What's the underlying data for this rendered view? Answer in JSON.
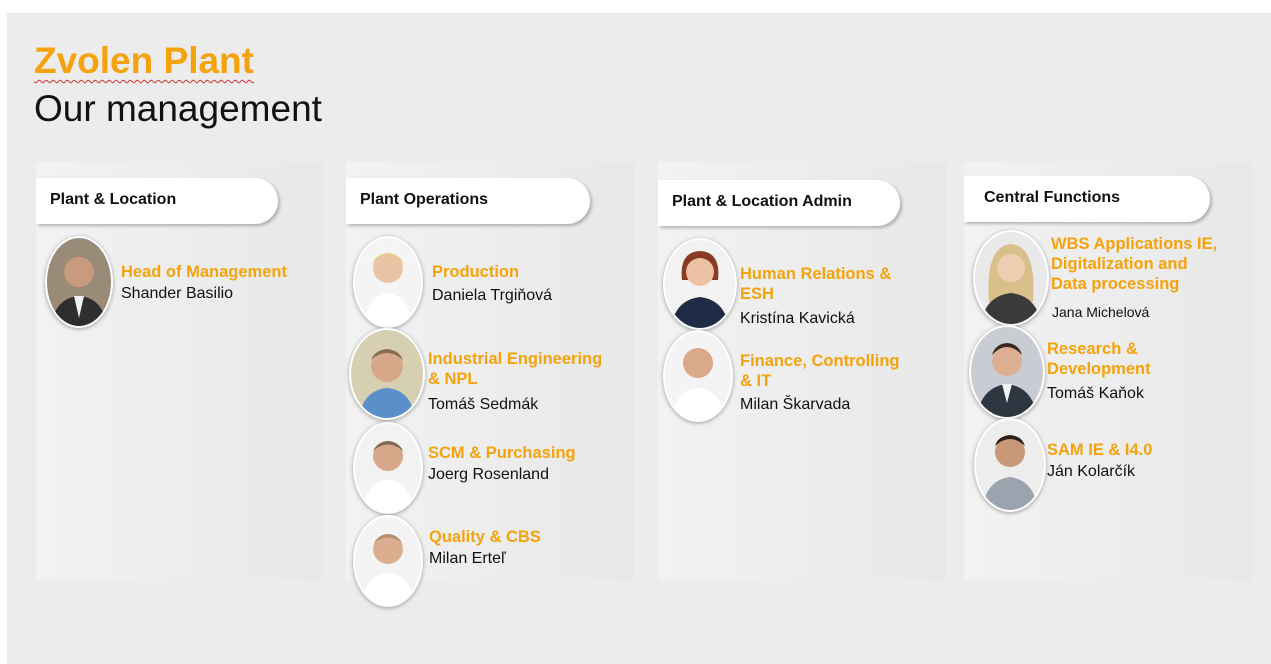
{
  "title": {
    "main": "Zvolen Plant",
    "sub": "Our management"
  },
  "columns": [
    {
      "header": "Plant & Location",
      "people": [
        {
          "role": "Head of Management",
          "name": "Shander Basilio"
        }
      ]
    },
    {
      "header": "Plant Operations",
      "people": [
        {
          "role": "Production",
          "name": "Daniela Trgiňová"
        },
        {
          "role_lines": [
            "Industrial Engineering",
            "& NPL"
          ],
          "name": "Tomáš Sedmák"
        },
        {
          "role": "SCM & Purchasing",
          "name": "Joerg Rosenland"
        },
        {
          "role": "Quality & CBS",
          "name": "Milan Erteľ"
        }
      ]
    },
    {
      "header": "Plant & Location Admin",
      "people": [
        {
          "role_lines": [
            "Human Relations &",
            "ESH"
          ],
          "name": "Kristína Kavická"
        },
        {
          "role_lines": [
            "Finance, Controlling",
            "& IT"
          ],
          "name": "Milan Škarvada"
        }
      ]
    },
    {
      "header": "Central Functions",
      "people": [
        {
          "role_lines": [
            "WBS Applications IE,",
            "Digitalization and",
            "Data processing"
          ],
          "name": "Jana Michelová"
        },
        {
          "role_lines": [
            "Research &",
            "Development"
          ],
          "name": "Tomáš Kaňok"
        },
        {
          "role": "SAM IE & I4.0",
          "name": "Ján Kolarčík"
        }
      ]
    }
  ],
  "colors": {
    "accent": "#f5a20c",
    "text": "#111111",
    "background": "#ececec"
  }
}
